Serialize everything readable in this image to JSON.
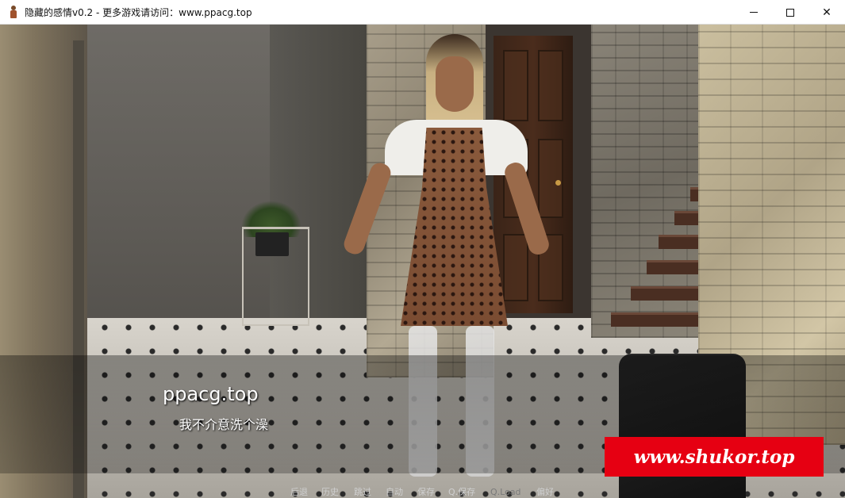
{
  "window": {
    "title": "隐藏的感情v0.2 - 更多游戏请访问：www.ppacg.top",
    "icon": "character-icon"
  },
  "dialogue": {
    "speaker": "ppacg.top",
    "text": "我不介意洗个澡"
  },
  "quick_menu": {
    "items": [
      {
        "label": "后退",
        "enabled": true
      },
      {
        "label": "历史",
        "enabled": true
      },
      {
        "label": "跳过",
        "enabled": true
      },
      {
        "label": "自动",
        "enabled": true
      },
      {
        "label": "保存",
        "enabled": true
      },
      {
        "label": "Q.保存",
        "enabled": true
      },
      {
        "label": "Q.Load",
        "enabled": false
      },
      {
        "label": "偏好",
        "enabled": true
      }
    ]
  },
  "watermark": {
    "text": "www.shukor.top",
    "color": "#e60012"
  }
}
